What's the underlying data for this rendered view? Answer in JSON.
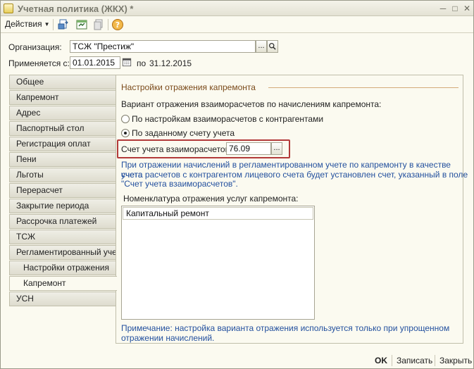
{
  "window": {
    "title": "Учетная политика (ЖКХ) *",
    "controls": [
      "minimize-icon",
      "maximize-icon",
      "close-icon"
    ]
  },
  "toolbar": {
    "actions_label": "Действия",
    "icons": [
      "export-icon",
      "refresh-icon",
      "copy-icon",
      "help-icon"
    ]
  },
  "organization": {
    "label": "Организация:",
    "value": "ТСЖ \"Престиж\"",
    "select_label": "...",
    "search_icon": "search-icon"
  },
  "period": {
    "label": "Применяется с:",
    "from": "01.01.2015",
    "to_label": "по",
    "to": "31.12.2015",
    "calendar_icon": "calendar-icon"
  },
  "tabs": [
    {
      "label": "Общее"
    },
    {
      "label": "Капремонт"
    },
    {
      "label": "Адрес"
    },
    {
      "label": "Паспортный стол"
    },
    {
      "label": "Регистрация оплат"
    },
    {
      "label": "Пени"
    },
    {
      "label": "Льготы"
    },
    {
      "label": "Перерасчет"
    },
    {
      "label": "Закрытие периода"
    },
    {
      "label": "Рассрочка платежей"
    },
    {
      "label": "ТСЖ"
    },
    {
      "label": "Регламентированный учет"
    },
    {
      "label": "Настройки отражения"
    },
    {
      "label": "Капремонт"
    },
    {
      "label": "УСН"
    }
  ],
  "active_tab_index": 13,
  "section": {
    "title": "Настройки отражения капремонта",
    "variant_label": "Вариант отражения взаиморасчетов по начислениям капремонта:",
    "options": [
      {
        "label": "По настройкам взаиморасчетов с контрагентами",
        "selected": false
      },
      {
        "label": "По заданному счету учета",
        "selected": true
      }
    ],
    "account_label": "Счет учета взаиморасчетов:",
    "account_value": "76.09",
    "account_select_label": "...",
    "info_lines": [
      "При отражении начислений в регламентированном учете по капремонту в качестве счета",
      "учета расчетов с контрагентом лицевого счета будет установлен счет, указанный в поле",
      "\"Счет учета взаиморасчетов\"."
    ],
    "nomenclature_label": "Номенклатура отражения услуг капремонта:",
    "nomenclature_items": [
      "Капитальный ремонт"
    ],
    "note_lines": [
      "Примечание: настройка варианта отражения используется только при упрощенном",
      "отражении начислений."
    ]
  },
  "footer": {
    "ok_label": "OK",
    "save_label": "Записать",
    "close_label": "Закрыть"
  },
  "colors": {
    "window_bg": "#fbfaf0",
    "section_title": "#7a4a1a",
    "note_text": "#23509e",
    "highlight_border": "#b23a3a"
  }
}
